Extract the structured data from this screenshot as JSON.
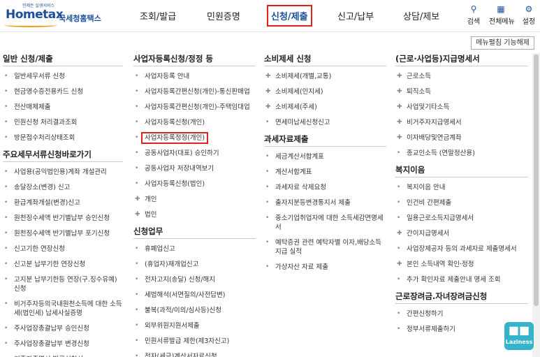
{
  "header": {
    "logo": {
      "tagline": "언제든 실생서비스",
      "brand": "Hometax",
      "subtitle": "국세청홈택스"
    },
    "nav": [
      {
        "label": "조회/발급"
      },
      {
        "label": "민원증명"
      },
      {
        "label": "신청/제출",
        "active": true
      },
      {
        "label": "신고/납부"
      },
      {
        "label": "상담/제보"
      }
    ],
    "util": {
      "search": "검색",
      "all_menu": "전체메뉴",
      "settings": "설정"
    },
    "menu_release": "메뉴펼침 기능해제"
  },
  "columns": [
    {
      "sections": [
        {
          "title": "일반 신청/제출",
          "items": [
            {
              "label": "일반세무서류 신청"
            },
            {
              "label": "현금영수증전용카드 신청"
            },
            {
              "label": "전산매체제출"
            },
            {
              "label": "민원신청 처리결과조회"
            },
            {
              "label": "방문접수처리상태조회"
            }
          ]
        },
        {
          "title": "주요세무서류신청바로가기",
          "items": [
            {
              "label": "사업용(공익법인용)계좌 개설관리"
            },
            {
              "label": "송달장소(변경) 신고"
            },
            {
              "label": "환급계좌개설(변경)신고"
            },
            {
              "label": "원천징수세액 반기별납부 승인신청"
            },
            {
              "label": "원천징수세액 반기별납부 포기신청"
            },
            {
              "label": "신고기한 연장신청"
            },
            {
              "label": "신고분 납부기한 연장신청"
            },
            {
              "label": "고지분 납부기한등 연장(구.징수유예)신청"
            },
            {
              "label": "비거주자등의국내원천소득에 대한 소득세(법인세) 납세사실증명"
            },
            {
              "label": "주사업장총괄납부 승인신청"
            },
            {
              "label": "주사업장총괄납부 변경신청"
            },
            {
              "label": "거주자증명서 발급신청서"
            }
          ]
        }
      ]
    },
    {
      "sections": [
        {
          "title": "사업자등록신청/정정 등",
          "items": [
            {
              "label": "사업자등록 안내",
              "bullet": "dot"
            },
            {
              "label": "사업자등록간편신청(개인)-통신판매업",
              "bullet": "dot"
            },
            {
              "label": "사업자등록간편신청(개인)-주택임대업",
              "bullet": "dot"
            },
            {
              "label": "사업자등록신청(개인)",
              "bullet": "dot"
            },
            {
              "label": "사업자등록정정(개인)",
              "bullet": "dot",
              "highlight": true
            },
            {
              "label": "공동사업자(대표) 승인하기",
              "bullet": "dot"
            },
            {
              "label": "공동사업자 저장내역보기",
              "bullet": "dot"
            },
            {
              "label": "사업자등록신청(법인)",
              "bullet": "dot"
            },
            {
              "label": "개인",
              "bullet": "plus"
            },
            {
              "label": "법인",
              "bullet": "plus"
            }
          ]
        },
        {
          "title": "신청업무",
          "items": [
            {
              "label": "휴폐업신고",
              "bullet": "dot"
            },
            {
              "label": "(휴업자)재개업신고",
              "bullet": "dot"
            },
            {
              "label": "전자고지(송달) 신청/해지",
              "bullet": "dot"
            },
            {
              "label": "세법해석(서면질의/사전답변)",
              "bullet": "dot"
            },
            {
              "label": "불복(과적/이의/심사등)신청",
              "bullet": "dot"
            },
            {
              "label": "외부위원지원서제출",
              "bullet": "dot"
            },
            {
              "label": "민원서류발급 제한(제3자신고)",
              "bullet": "dot"
            },
            {
              "label": "전자(세금)계산서자료신청",
              "bullet": "dot"
            }
          ]
        }
      ]
    },
    {
      "sections": [
        {
          "title": "소비제세 신청",
          "items": [
            {
              "label": "소비제세(개별,교통)",
              "bullet": "plus"
            },
            {
              "label": "소비제세(인지세)",
              "bullet": "plus"
            },
            {
              "label": "소비제세(주세)",
              "bullet": "plus"
            },
            {
              "label": "면세미납세신청신고",
              "bullet": "dot"
            }
          ]
        },
        {
          "title": "과세자료제출",
          "items": [
            {
              "label": "세금계산서합계표",
              "bullet": "dot"
            },
            {
              "label": "계산서합계표",
              "bullet": "dot"
            },
            {
              "label": "과세자료 삭제요청",
              "bullet": "dot"
            },
            {
              "label": "출자지분등변경통지서 제출",
              "bullet": "dot"
            },
            {
              "label": "중소기업취업자에 대한 소득세감면명세서",
              "bullet": "dot"
            },
            {
              "label": "예탁증권 관련 예탁자별 이자,배당소득지급 실적",
              "bullet": "dot"
            },
            {
              "label": "가상자산 자료 제출",
              "bullet": "dot"
            }
          ]
        }
      ]
    },
    {
      "sections": [
        {
          "title": "(근로·사업등)지급명세서",
          "items": [
            {
              "label": "근로소득",
              "bullet": "plus"
            },
            {
              "label": "퇴직소득",
              "bullet": "plus"
            },
            {
              "label": "사업및기타소득",
              "bullet": "plus"
            },
            {
              "label": "비거주자지급명세서",
              "bullet": "plus"
            },
            {
              "label": "이자배당및연금계좌",
              "bullet": "plus"
            },
            {
              "label": "종교인소득 (연말정산용)",
              "bullet": "dot"
            }
          ]
        },
        {
          "title": "복지이음",
          "items": [
            {
              "label": "복지이음 안내",
              "bullet": "dot"
            },
            {
              "label": "인건비 간편제출",
              "bullet": "dot"
            },
            {
              "label": "일용근로소득지급명세서",
              "bullet": "dot"
            },
            {
              "label": "간이지급명세서",
              "bullet": "plus"
            },
            {
              "label": "사업장제공자 등의 과세자료 제출명세서",
              "bullet": "dot"
            },
            {
              "label": "본인 소득내역 확인·정정",
              "bullet": "plus"
            },
            {
              "label": "추가 확인자료 제출안내 명세 조회",
              "bullet": "dot"
            }
          ]
        },
        {
          "title": "근로장려금.자녀장려금신청",
          "items": [
            {
              "label": "간편신청하기",
              "bullet": "dot"
            },
            {
              "label": "정부서류제출하기",
              "bullet": "dot"
            }
          ]
        }
      ]
    }
  ],
  "widget": {
    "label": "Laziness"
  }
}
